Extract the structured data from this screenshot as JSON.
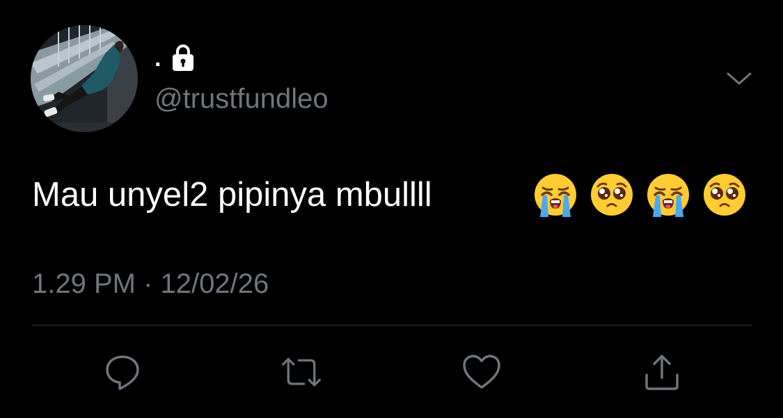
{
  "user": {
    "display_name": ".",
    "handle": "@trustfundleo",
    "protected": true
  },
  "tweet": {
    "text": "Mau unyel2 pipinya mbullll",
    "emojis": [
      "loudly-crying-face",
      "pleading-face",
      "loudly-crying-face",
      "pleading-face"
    ],
    "timestamp": "1.29 PM · 12/02/26"
  },
  "actions": [
    "reply",
    "retweet",
    "like",
    "share"
  ],
  "colors": {
    "background": "#000000",
    "text_primary": "#ffffff",
    "text_secondary": "#6e767d",
    "divider": "#2f3336",
    "icon": "#6e767d"
  }
}
